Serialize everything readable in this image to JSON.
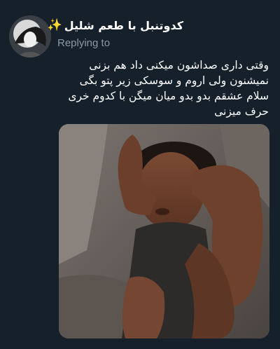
{
  "tweet": {
    "display_name": "کدوتنبل با طعم شلیل",
    "name_emoji": "✨",
    "replying_label": "Replying to",
    "text": "وقتی داری صداشون میکنی داد هم بزنی نمیشنون ولی اروم و سوسکی زیر پتو بگی سلام عشقم بدو بدو میان میگن با کدوم خری حرف میزنی"
  },
  "icons": {
    "sparkle": "sparkle-emoji",
    "avatar": "profile-avatar"
  },
  "colors": {
    "background": "#15202b",
    "secondary_text": "#8b98a5",
    "primary_text": "#ffffff",
    "sparkle": "#ffd54a"
  }
}
